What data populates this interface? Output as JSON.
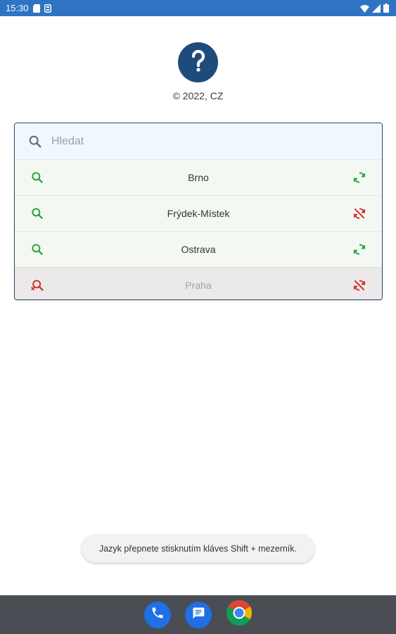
{
  "status_bar": {
    "time": "15:30",
    "left_icons": [
      "sd-card-icon",
      "storage-icon"
    ],
    "right_icons": [
      "wifi-icon",
      "signal-icon",
      "battery-icon"
    ],
    "color": "#2e74c2"
  },
  "header": {
    "logo_icon": "question-mark-icon",
    "copyright": "© 2022, CZ"
  },
  "search": {
    "placeholder": "Hledat",
    "value": ""
  },
  "list": {
    "items": [
      {
        "label": "Brno",
        "left_icon": "search-icon",
        "left_color": "#2aa33a",
        "right_icon": "sync-icon",
        "right_color": "#2aa33a",
        "active": true
      },
      {
        "label": "Frýdek-Místek",
        "left_icon": "search-icon",
        "left_color": "#2aa33a",
        "right_icon": "sync-disabled-icon",
        "right_color": "#d32f2f",
        "active": true
      },
      {
        "label": "Ostrava",
        "left_icon": "search-icon",
        "left_color": "#2aa33a",
        "right_icon": "sync-icon",
        "right_color": "#2aa33a",
        "active": true
      },
      {
        "label": "Praha",
        "left_icon": "search-off-icon",
        "left_color": "#d32f2f",
        "right_icon": "sync-disabled-icon",
        "right_color": "#d32f2f",
        "active": false
      }
    ]
  },
  "toast": {
    "text": "Jazyk přepnete stisknutím kláves Shift + mezerník."
  },
  "dock": {
    "apps": [
      "phone-icon",
      "messages-icon",
      "chrome-icon"
    ]
  },
  "colors": {
    "accent": "#2e74c2",
    "logo": "#1d4c7c",
    "ok": "#2aa33a",
    "error": "#d32f2f"
  }
}
